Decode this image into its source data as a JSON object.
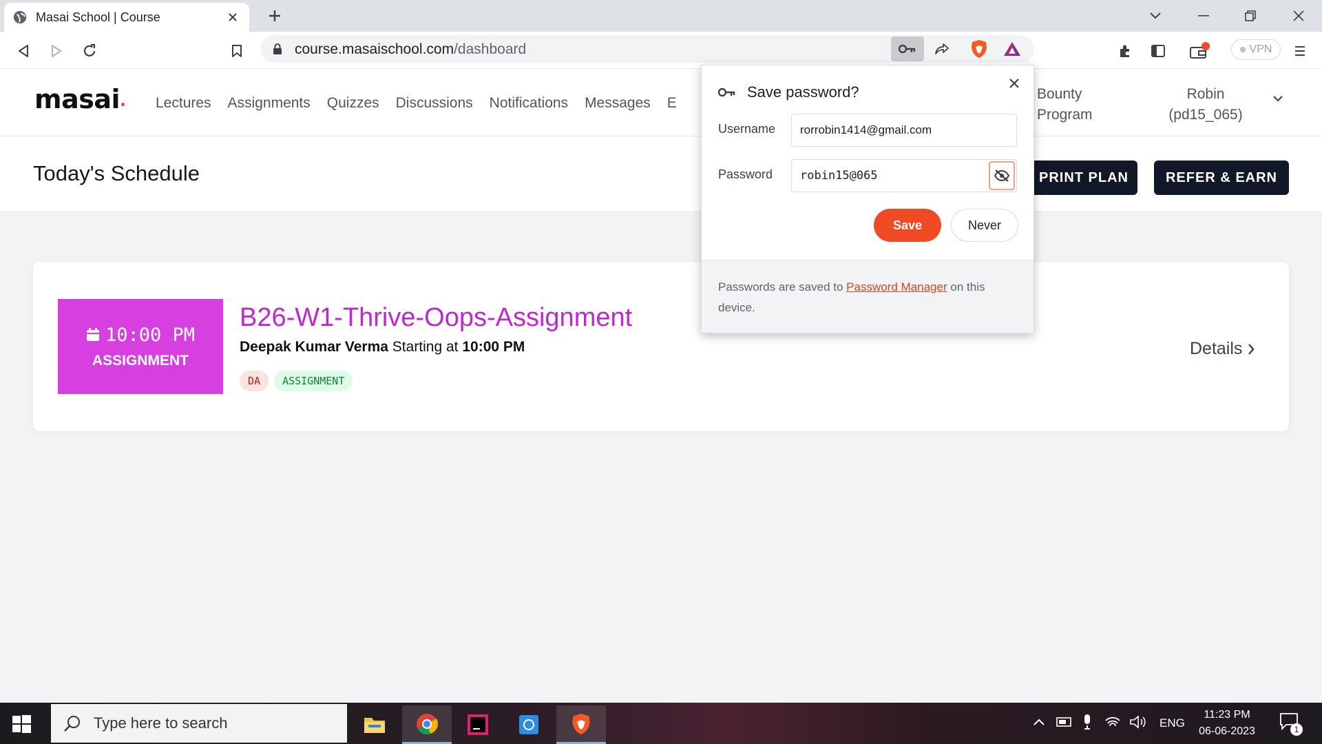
{
  "browser": {
    "tab_title": "Masai School | Course",
    "url_host": "course.masaischool.com",
    "url_path": "/dashboard",
    "vpn_label": "VPN"
  },
  "site": {
    "logo": "masai",
    "nav": [
      "Lectures",
      "Assignments",
      "Quizzes",
      "Discussions",
      "Notifications",
      "Messages",
      "E"
    ],
    "bounty_line1": "Bounty",
    "bounty_line2": "Program",
    "user_line1": "Robin",
    "user_line2": "(pd15_065)"
  },
  "schedule": {
    "title": "Today's Schedule",
    "sprint_plan": "PRINT PLAN",
    "refer_earn": "REFER & EARN"
  },
  "assignment": {
    "time": "10:00 PM",
    "kind": "ASSIGNMENT",
    "title": "B26-W1-Thrive-Oops-Assignment",
    "instructor": "Deepak Kumar Verma",
    "starting_at": "Starting at",
    "start_time": "10:00 PM",
    "tags": [
      "DA",
      "ASSIGNMENT"
    ],
    "details": "Details"
  },
  "password_popup": {
    "title": "Save password?",
    "username_label": "Username",
    "username_value": "rorrobin1414@gmail.com",
    "password_label": "Password",
    "password_value": "robin15@065",
    "save_label": "Save",
    "never_label": "Never",
    "footer_pre": "Passwords are saved to",
    "footer_link": "Password Manager",
    "footer_post": "on this device."
  },
  "taskbar": {
    "search_placeholder": "Type here to search",
    "language": "ENG",
    "time": "11:23 PM",
    "date": "06-06-2023",
    "notification_count": "1"
  },
  "colors": {
    "accent_magenta": "#d83fe0",
    "title_magenta": "#c026d3",
    "save_orange": "#f04a24",
    "dark_button": "#111827"
  }
}
